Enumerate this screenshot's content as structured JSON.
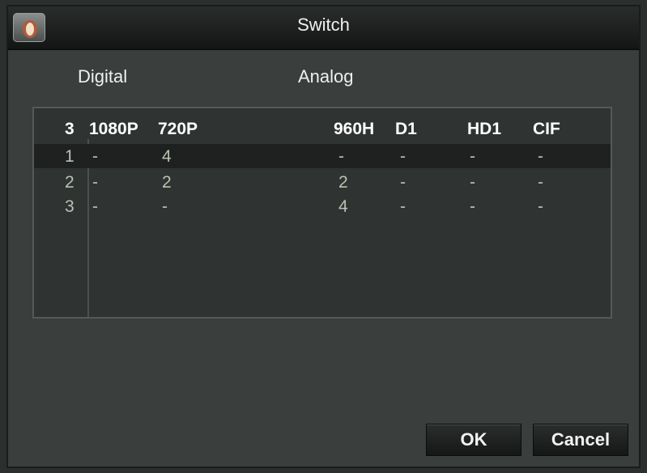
{
  "window": {
    "title": "Switch"
  },
  "headers": {
    "digital": "Digital",
    "analog": "Analog"
  },
  "table": {
    "columns": [
      "3",
      "1080P",
      "720P",
      "960H",
      "D1",
      "HD1",
      "CIF"
    ],
    "rows": [
      [
        "1",
        "-",
        "4",
        "-",
        "-",
        "-",
        "-"
      ],
      [
        "2",
        "-",
        "2",
        "2",
        "-",
        "-",
        "-"
      ],
      [
        "3",
        "-",
        "-",
        "4",
        "-",
        "-",
        "-"
      ]
    ],
    "selected_row": 0
  },
  "buttons": {
    "ok": "OK",
    "cancel": "Cancel"
  },
  "icons": {
    "app": "app-logo-icon"
  }
}
